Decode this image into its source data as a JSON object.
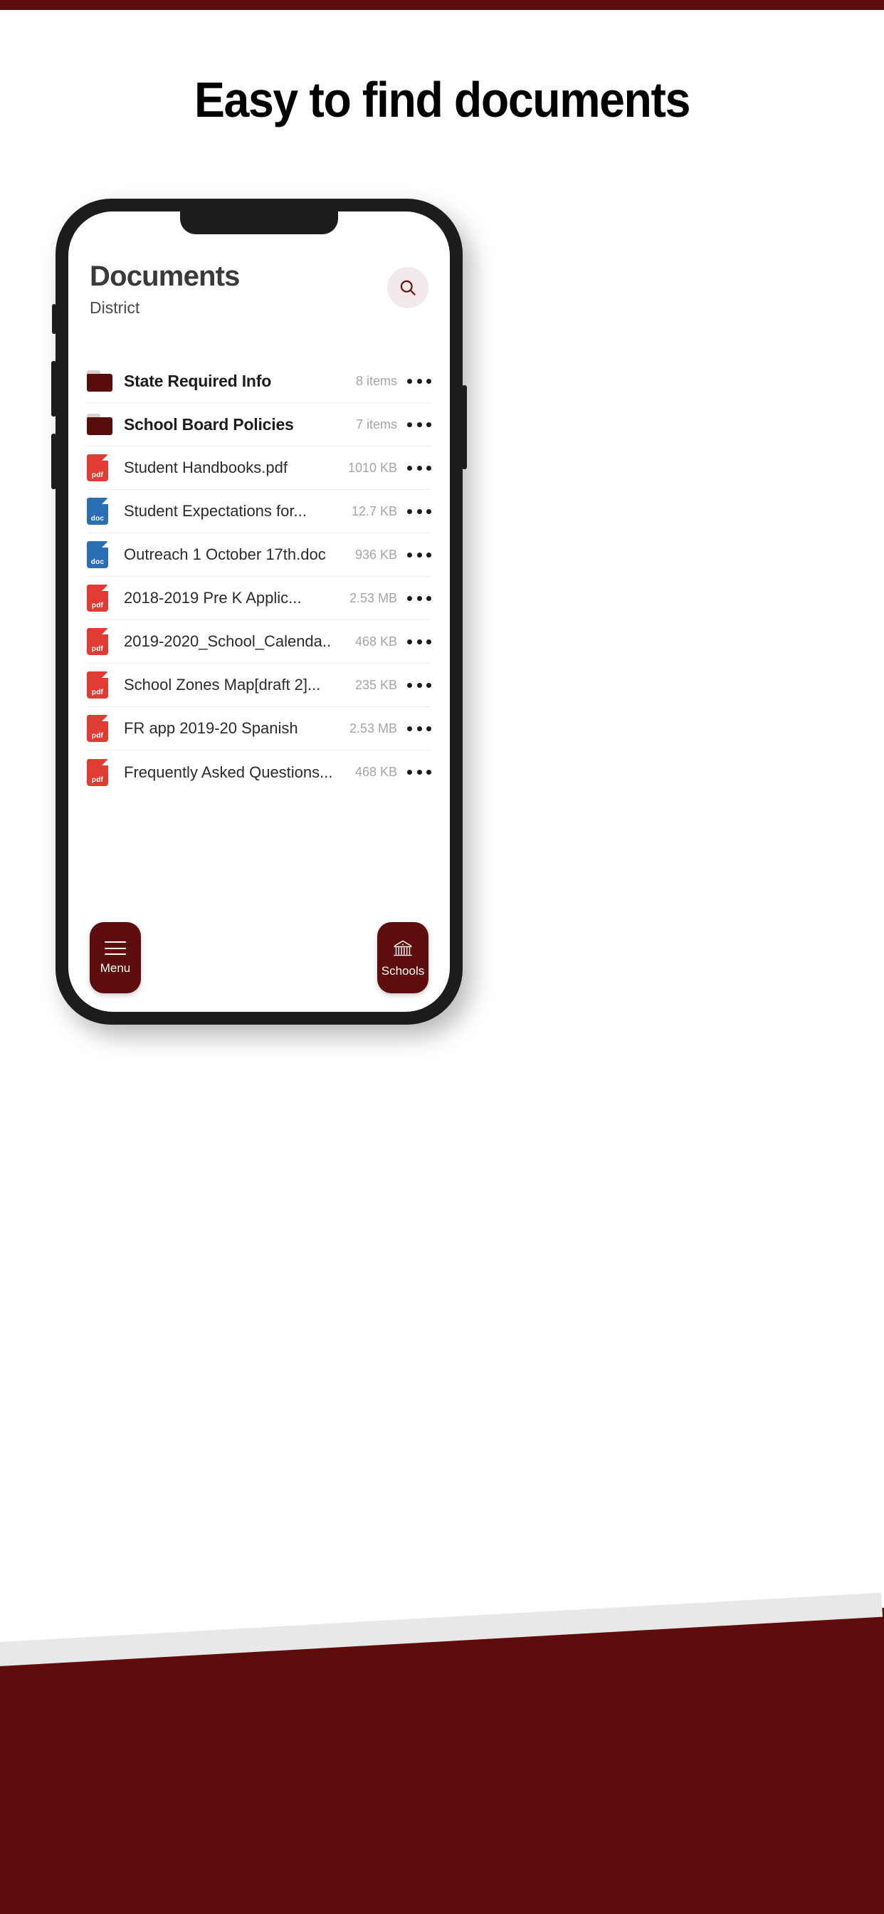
{
  "promo": {
    "headline": "Easy to find documents"
  },
  "colors": {
    "brand_maroon": "#5e0c0c",
    "folder_maroon": "#590c0c",
    "pdf_red": "#e23b34",
    "doc_blue": "#2a6fb5",
    "search_circle": "#f2e9ea",
    "meta_gray": "#a5a5a5"
  },
  "app": {
    "title": "Documents",
    "subtitle": "District",
    "search_icon": "search-icon",
    "items": [
      {
        "kind": "folder",
        "icon": "folder-icon",
        "name": "State Required Info",
        "meta": "8 items",
        "more": "more-options-icon"
      },
      {
        "kind": "folder",
        "icon": "folder-icon",
        "name": "School Board Policies",
        "meta": "7 items",
        "more": "more-options-icon"
      },
      {
        "kind": "pdf",
        "icon": "pdf-file-icon",
        "ext": "pdf",
        "name": "Student Handbooks.pdf",
        "meta": "1010 KB",
        "more": "more-options-icon"
      },
      {
        "kind": "doc",
        "icon": "doc-file-icon",
        "ext": "doc",
        "name": "Student Expectations for...",
        "meta": "12.7 KB",
        "more": "more-options-icon"
      },
      {
        "kind": "doc",
        "icon": "doc-file-icon",
        "ext": "doc",
        "name": "Outreach 1 October 17th.doc",
        "meta": "936 KB",
        "more": "more-options-icon"
      },
      {
        "kind": "pdf",
        "icon": "pdf-file-icon",
        "ext": "pdf",
        "name": "2018-2019 Pre K Applic...",
        "meta": "2.53 MB",
        "more": "more-options-icon"
      },
      {
        "kind": "pdf",
        "icon": "pdf-file-icon",
        "ext": "pdf",
        "name": "2019-2020_School_Calenda..",
        "meta": "468 KB",
        "more": "more-options-icon"
      },
      {
        "kind": "pdf",
        "icon": "pdf-file-icon",
        "ext": "pdf",
        "name": "School Zones Map[draft 2]...",
        "meta": "235 KB",
        "more": "more-options-icon"
      },
      {
        "kind": "pdf",
        "icon": "pdf-file-icon",
        "ext": "pdf",
        "name": "FR app 2019-20 Spanish",
        "meta": "2.53 MB",
        "more": "more-options-icon"
      },
      {
        "kind": "pdf",
        "icon": "pdf-file-icon",
        "ext": "pdf",
        "name": "Frequently Asked Questions...",
        "meta": "468 KB",
        "more": "more-options-icon"
      }
    ],
    "bottom_nav": [
      {
        "id": "menu",
        "label": "Menu",
        "icon": "hamburger-menu-icon"
      },
      {
        "id": "schools",
        "label": "Schools",
        "icon": "school-building-icon"
      }
    ]
  }
}
